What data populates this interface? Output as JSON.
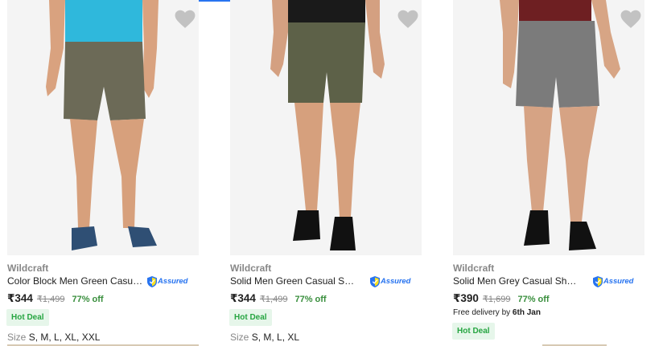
{
  "products": [
    {
      "brand": "Wildcraft",
      "title": "Color Block Men Green Casual Shorts",
      "assured": "Assured",
      "price": "₹344",
      "mrp": "₹1,499",
      "discount": "77% off",
      "badge": "Hot Deal",
      "size_label": "Size",
      "sizes": "S, M, L, XL, XXL",
      "shirt_color": "#2fb8dc",
      "shorts_color": "#6c6a57",
      "shoe_color": "#2f4f74"
    },
    {
      "brand": "Wildcraft",
      "title": "Solid Men Green Casual Shorts",
      "assured": "Assured",
      "price": "₹344",
      "mrp": "₹1,499",
      "discount": "77% off",
      "badge": "Hot Deal",
      "size_label": "Size",
      "sizes": "S, M, L, XL",
      "shirt_color": "#1a1a1a",
      "shorts_color": "#5d6148",
      "shoe_color": "#111111"
    },
    {
      "brand": "Wildcraft",
      "title": "Solid Men Grey Casual Shorts",
      "assured": "Assured",
      "price": "₹390",
      "mrp": "₹1,699",
      "discount": "77% off",
      "delivery_prefix": "Free delivery by",
      "delivery_date": "6th Jan",
      "badge": "Hot Deal",
      "shirt_color": "#6e1f22",
      "shorts_color": "#7b7b7b",
      "shoe_color": "#111111"
    }
  ],
  "icons": {
    "wishlist": "heart-icon",
    "assured": "shield-icon"
  },
  "colors": {
    "accent": "#2874f0",
    "discount": "#388e3c",
    "deal_bg": "#e6f6ea",
    "deal_text": "#26a541",
    "muted": "#878787"
  }
}
